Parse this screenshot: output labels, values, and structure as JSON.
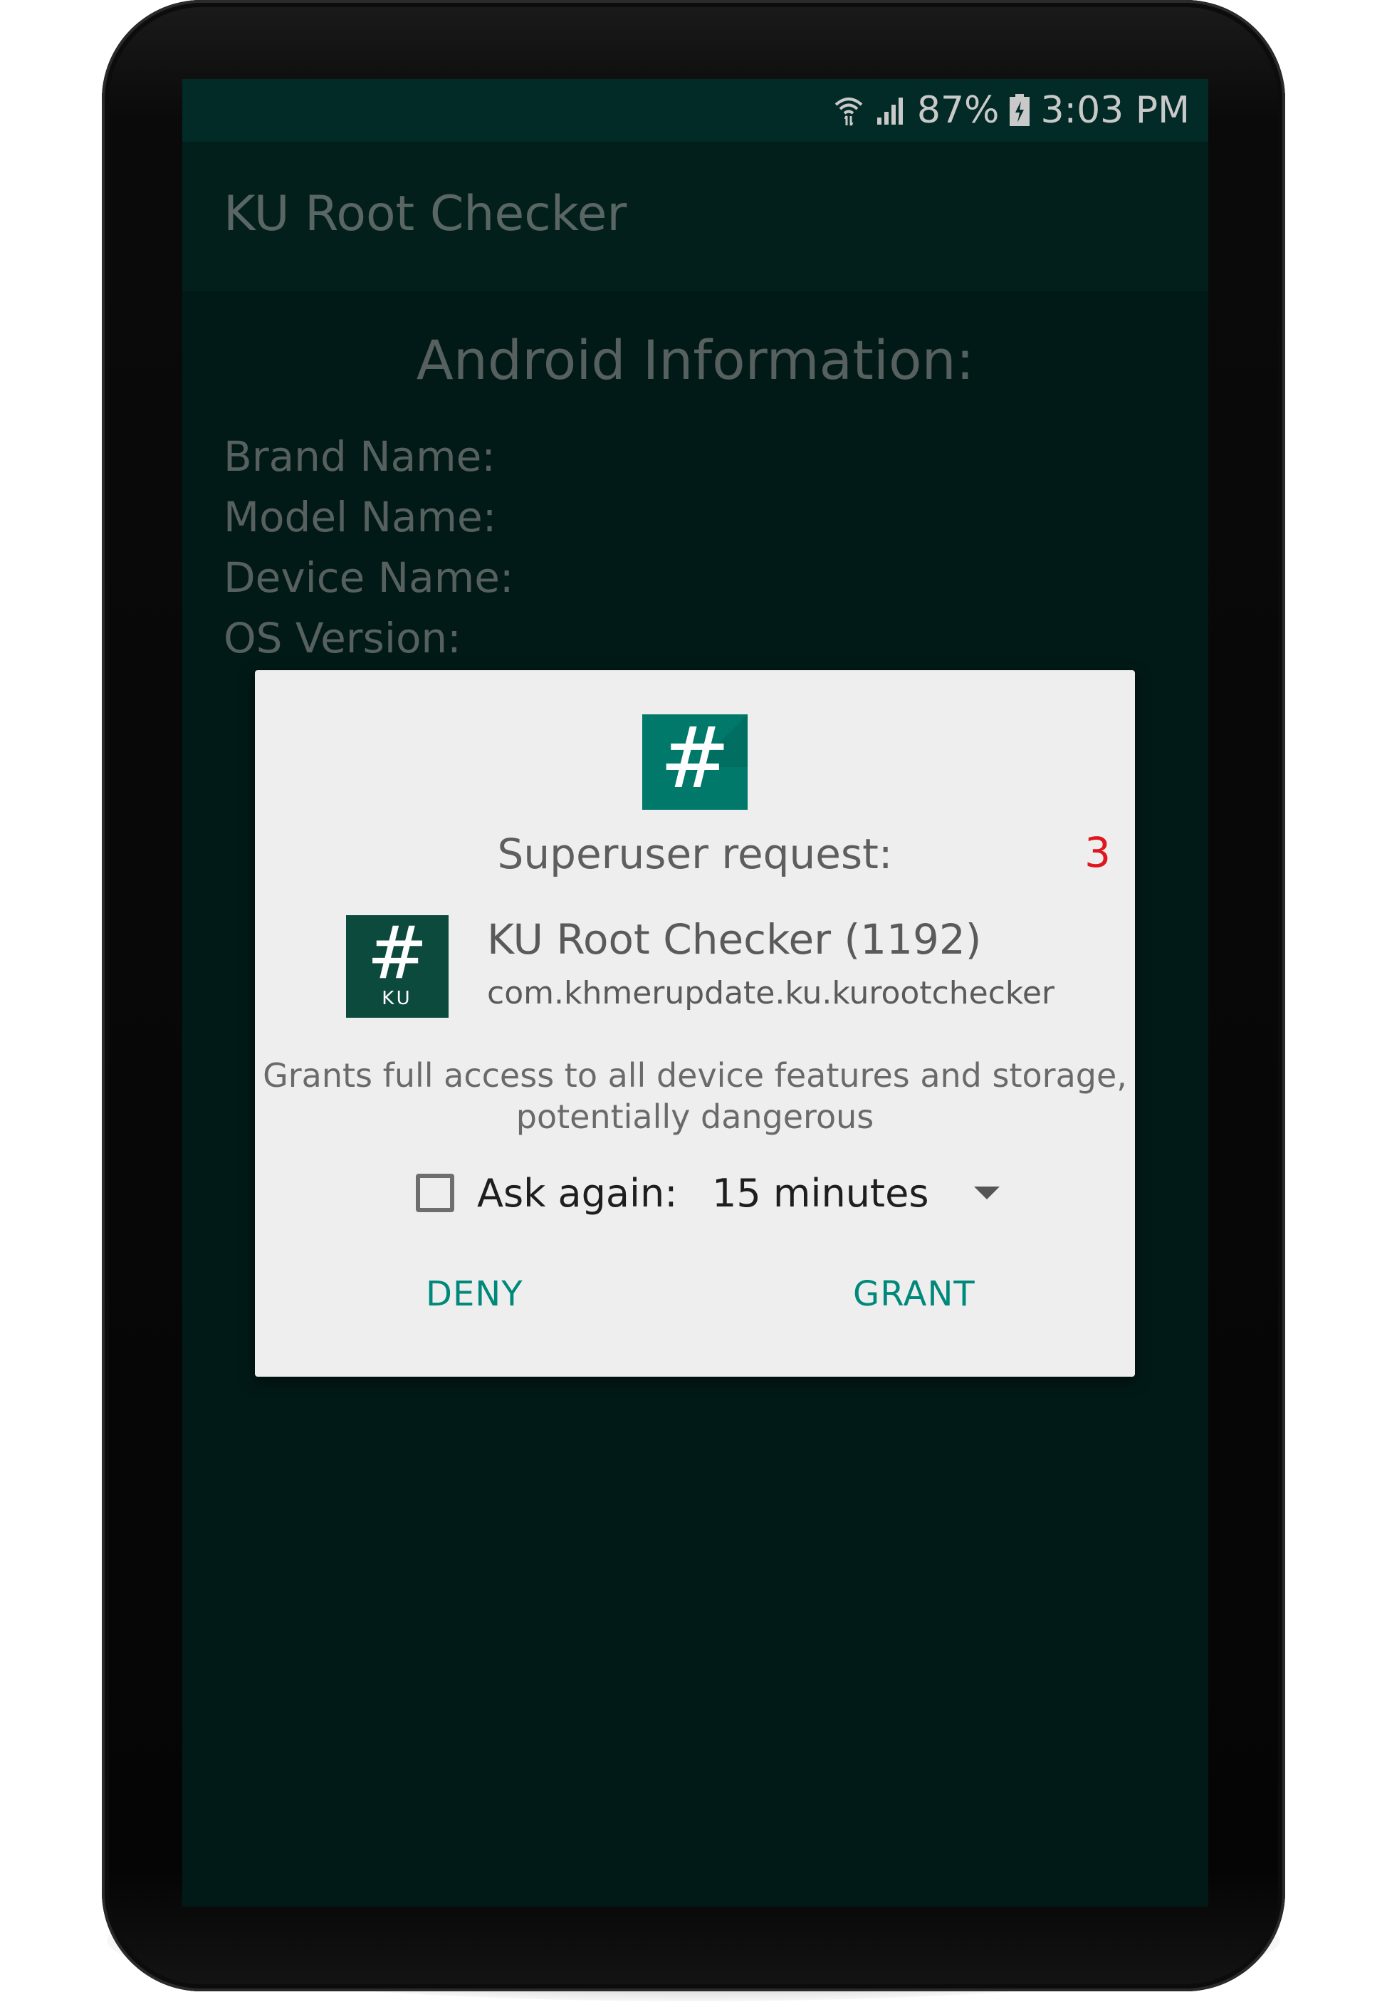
{
  "status_bar": {
    "battery": "87%",
    "time": "3:03 PM",
    "icons": [
      "wifi-icon",
      "signal-icon",
      "battery-charging-icon"
    ]
  },
  "app_bar": {
    "title": "KU Root Checker"
  },
  "content": {
    "heading": "Android Information:",
    "fields": [
      {
        "label": "Brand Name:"
      },
      {
        "label": "Model Name:"
      },
      {
        "label": "Device Name:"
      },
      {
        "label": "OS Version:"
      }
    ]
  },
  "dialog": {
    "icon": "superuser-hash-icon",
    "title": "Superuser request:",
    "countdown": "3",
    "app_icon": {
      "symbol": "#",
      "text": "KU"
    },
    "app_name": "KU Root Checker (1192)",
    "package": "com.khmerupdate.ku.kurootchecker",
    "warning_line1": "Grants full access to all device features and storage,",
    "warning_line2": "potentially dangerous",
    "ask_again_label": "Ask again:",
    "ask_again_checked": false,
    "duration_selected": "15 minutes",
    "deny_label": "DENY",
    "grant_label": "GRANT"
  },
  "colors": {
    "accent": "#00897b",
    "countdown": "#e0161f",
    "screen_background": "#021a17",
    "status_bar": "#022a26",
    "dialog_background": "#eeeeee"
  }
}
